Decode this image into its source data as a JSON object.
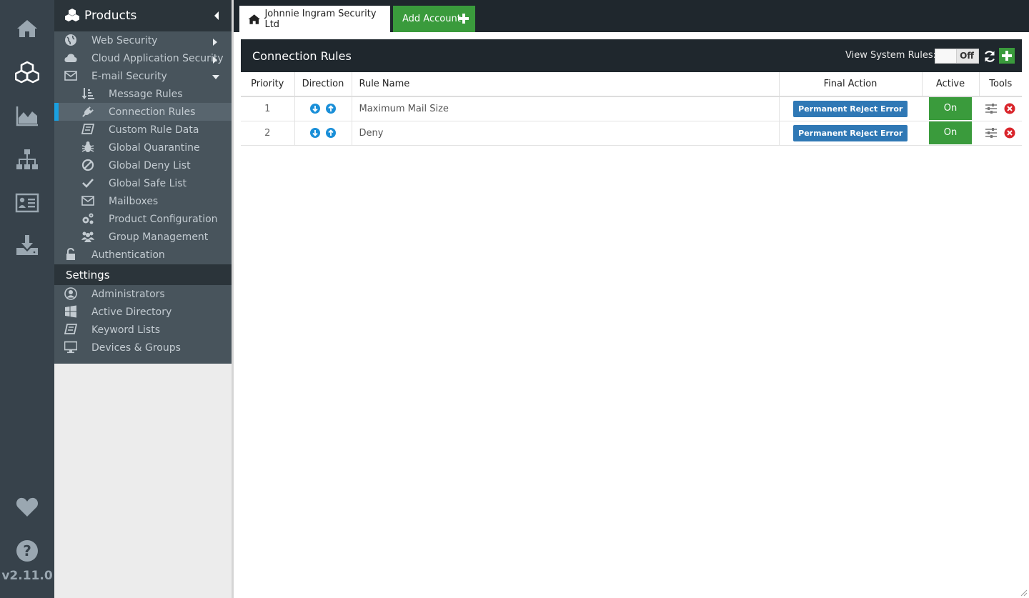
{
  "version": "v2.11.0",
  "rail": {
    "items": [
      {
        "icon": "home-icon"
      },
      {
        "icon": "cubes-icon"
      },
      {
        "icon": "area-chart-icon"
      },
      {
        "icon": "sitemap-icon"
      },
      {
        "icon": "address-card-icon"
      },
      {
        "icon": "download-icon"
      },
      {
        "icon": "heart-icon"
      },
      {
        "icon": "question-circle-icon"
      }
    ]
  },
  "sidebar": {
    "products_label": "Products",
    "web_security": "Web Security",
    "cloud_app_security": "Cloud Application Security",
    "email_security": "E-mail Security",
    "message_rules": "Message Rules",
    "connection_rules": "Connection Rules",
    "custom_rule_data": "Custom Rule Data",
    "global_quarantine": "Global Quarantine",
    "global_deny_list": "Global Deny List",
    "global_safe_list": "Global Safe List",
    "mailboxes": "Mailboxes",
    "product_configuration": "Product Configuration",
    "group_management": "Group Management",
    "authentication": "Authentication",
    "settings_label": "Settings",
    "administrators": "Administrators",
    "active_directory": "Active Directory",
    "keyword_lists": "Keyword Lists",
    "devices_groups": "Devices & Groups"
  },
  "topbar": {
    "account_tab": "Johnnie Ingram Security Ltd",
    "add_account": "Add Account"
  },
  "panel": {
    "title": "Connection Rules",
    "view_system_rules_label": "View System Rules:",
    "toggle_value": "Off"
  },
  "table": {
    "headers": {
      "priority": "Priority",
      "direction": "Direction",
      "rule_name": "Rule Name",
      "final_action": "Final Action",
      "active": "Active",
      "tools": "Tools"
    },
    "rows": [
      {
        "priority": "1",
        "rule_name": "Maximum Mail Size",
        "final_action": "Permanent Reject Error",
        "active": "On"
      },
      {
        "priority": "2",
        "rule_name": "Deny",
        "final_action": "Permanent Reject Error",
        "active": "On"
      }
    ]
  },
  "colors": {
    "accent_blue": "#1aa0e0",
    "green": "#3a9b3c",
    "badge_blue": "#2f78b5",
    "delete_red": "#d9252b"
  }
}
